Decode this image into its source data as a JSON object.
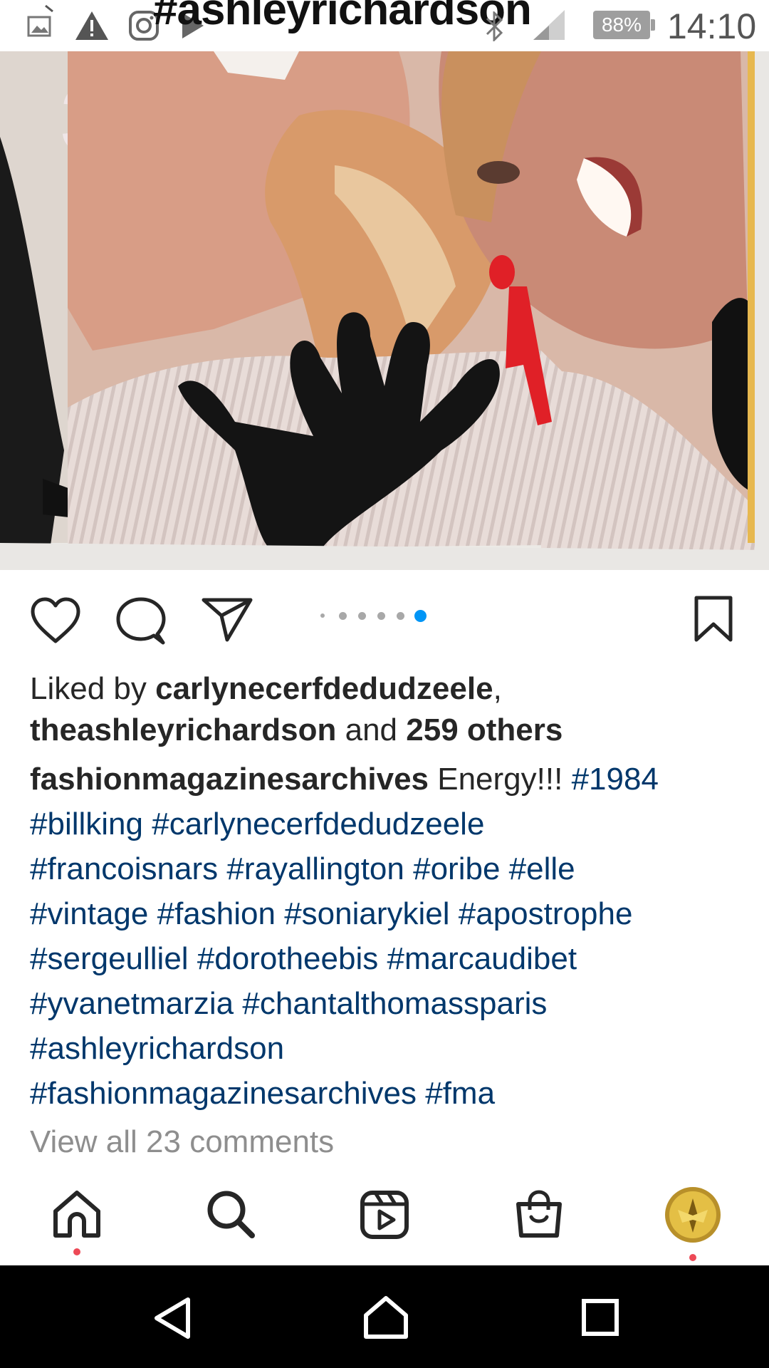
{
  "status_bar": {
    "title_overlay": "#ashleyrichardson",
    "battery": "88%",
    "time": "14:10",
    "icons": [
      "gallery-icon",
      "warning-icon",
      "instagram-icon",
      "play-store-icon",
      "bluetooth-icon",
      "signal-icon",
      "battery-icon"
    ]
  },
  "post": {
    "carousel": {
      "count": 6,
      "active_index": 5
    },
    "actions": [
      "like-icon",
      "comment-icon",
      "share-icon",
      "save-icon"
    ],
    "likes": {
      "prefix": "Liked by ",
      "user1": "carlynecerfdedudzeele",
      "sep": ",",
      "user2": "theashleyrichardson",
      "and": " and ",
      "others": "259 others"
    },
    "caption": {
      "username": "fashionmagazinesarchives",
      "text": " Energy!!! ",
      "tags": [
        "#1984",
        "#billking",
        "#carlynecerfdedudzeele",
        "#francoisnars",
        "#rayallington",
        "#oribe",
        "#elle",
        "#vintage",
        "#fashion",
        "#soniarykiel",
        "#apostrophe",
        "#sergeulliel",
        "#dorotheebis",
        "#marcaudibet",
        "#yvanetmarzia",
        "#chantalthomassparis",
        "#ashleyrichardson",
        "#fashionmagazinesarchives",
        "#fma"
      ]
    },
    "view_comments": "View all 23 comments"
  },
  "bottom_nav": {
    "items": [
      "home-icon",
      "search-icon",
      "reels-icon",
      "shop-icon",
      "profile-avatar"
    ]
  },
  "android_nav": {
    "items": [
      "back-button",
      "home-button",
      "recents-button"
    ]
  },
  "colors": {
    "hashtag": "#00376b",
    "active_dot": "#0095f6",
    "notification_dot": "#ed4956"
  }
}
